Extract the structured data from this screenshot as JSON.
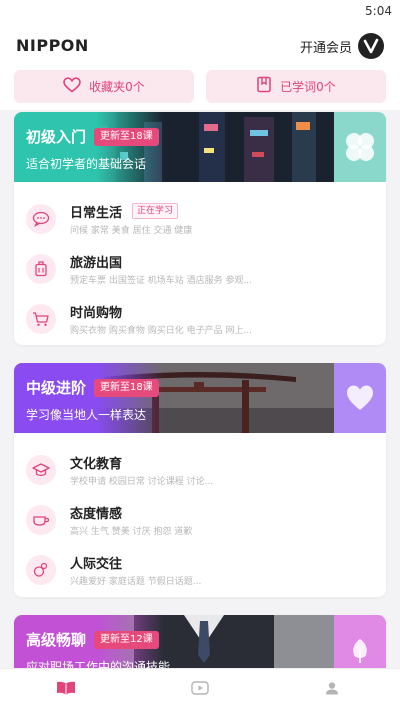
{
  "status_bar": {
    "time": "5:04"
  },
  "header": {
    "brand": "NIPPON",
    "vip_label": "开通会员",
    "vip_icon": "v-badge-icon"
  },
  "quick_links": [
    {
      "label": "收藏夹0个",
      "icon": "heart-icon"
    },
    {
      "label": "已学词0个",
      "icon": "book-icon"
    }
  ],
  "sections": [
    {
      "title": "初级入门",
      "badge": "更新至18课",
      "subtitle": "适合初学者的基础会话",
      "accent": "#2ec4ad",
      "side_icon": "clover-icon",
      "lessons": [
        {
          "title": "日常生活",
          "tag": "正在学习",
          "desc": "问候 家常 美食 居住 交通 健康",
          "icon": "chat-icon"
        },
        {
          "title": "旅游出国",
          "desc": "预定车票 出国签证 机场车站 酒店服务 参观...",
          "icon": "luggage-icon"
        },
        {
          "title": "时尚购物",
          "desc": "购买衣物 购买食物 购买日化 电子产品 网上...",
          "icon": "cart-icon"
        }
      ]
    },
    {
      "title": "中级进阶",
      "badge": "更新至18课",
      "subtitle": "学习像当地人一样表达",
      "accent": "#8a4cf0",
      "side_icon": "heart-icon",
      "lessons": [
        {
          "title": "文化教育",
          "desc": "学校申请 校园日常 讨论课程 讨论...",
          "icon": "graduation-cap-icon"
        },
        {
          "title": "态度情感",
          "desc": "高兴 生气 赞美 讨厌 抱怨 道歉",
          "icon": "cup-icon"
        },
        {
          "title": "人际交往",
          "desc": "兴趣爱好 家庭话题 节假日话题...",
          "icon": "people-icon"
        }
      ]
    },
    {
      "title": "高级畅聊",
      "badge": "更新至12课",
      "subtitle": "应对职场工作中的沟通技能",
      "accent": "#c251d6",
      "side_icon": "tulip-icon",
      "lessons": []
    }
  ],
  "tabbar": [
    {
      "name": "tab-study",
      "icon": "book-open-icon",
      "active": true
    },
    {
      "name": "tab-video",
      "icon": "play-icon",
      "active": false
    },
    {
      "name": "tab-profile",
      "icon": "user-icon",
      "active": false
    }
  ],
  "colors": {
    "primary": "#e0447a",
    "pill_bg": "#fbe7ee",
    "cyan": "#2ec4ad",
    "purple": "#8a4cf0",
    "magenta": "#c251d6"
  }
}
